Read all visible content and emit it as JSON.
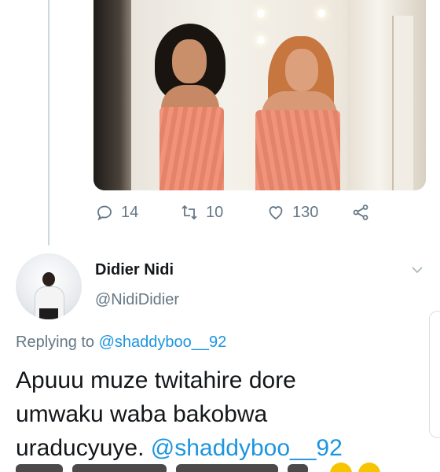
{
  "previous_tweet": {
    "media": {
      "alt": ""
    },
    "actions": {
      "reply_count": "14",
      "retweet_count": "10",
      "like_count": "130"
    }
  },
  "reply": {
    "display_name": "Didier Nidi",
    "handle": "@NidiDidier",
    "replying_prefix": "Replying to",
    "replying_to": "@shaddyboo__92",
    "text_line1": "Apuuu muze twitahire dore",
    "text_line2": "umwaku waba bakobwa",
    "text_line3": "uraducyuye.",
    "text_mention": "@shaddyboo__92"
  },
  "colors": {
    "accent": "#1b95e0",
    "secondary_text": "#657786",
    "primary_text": "#14171a",
    "thread_line": "#ccd6dd"
  },
  "icons": [
    "reply-icon",
    "retweet-icon",
    "like-icon",
    "share-icon",
    "chevron-down-icon"
  ]
}
